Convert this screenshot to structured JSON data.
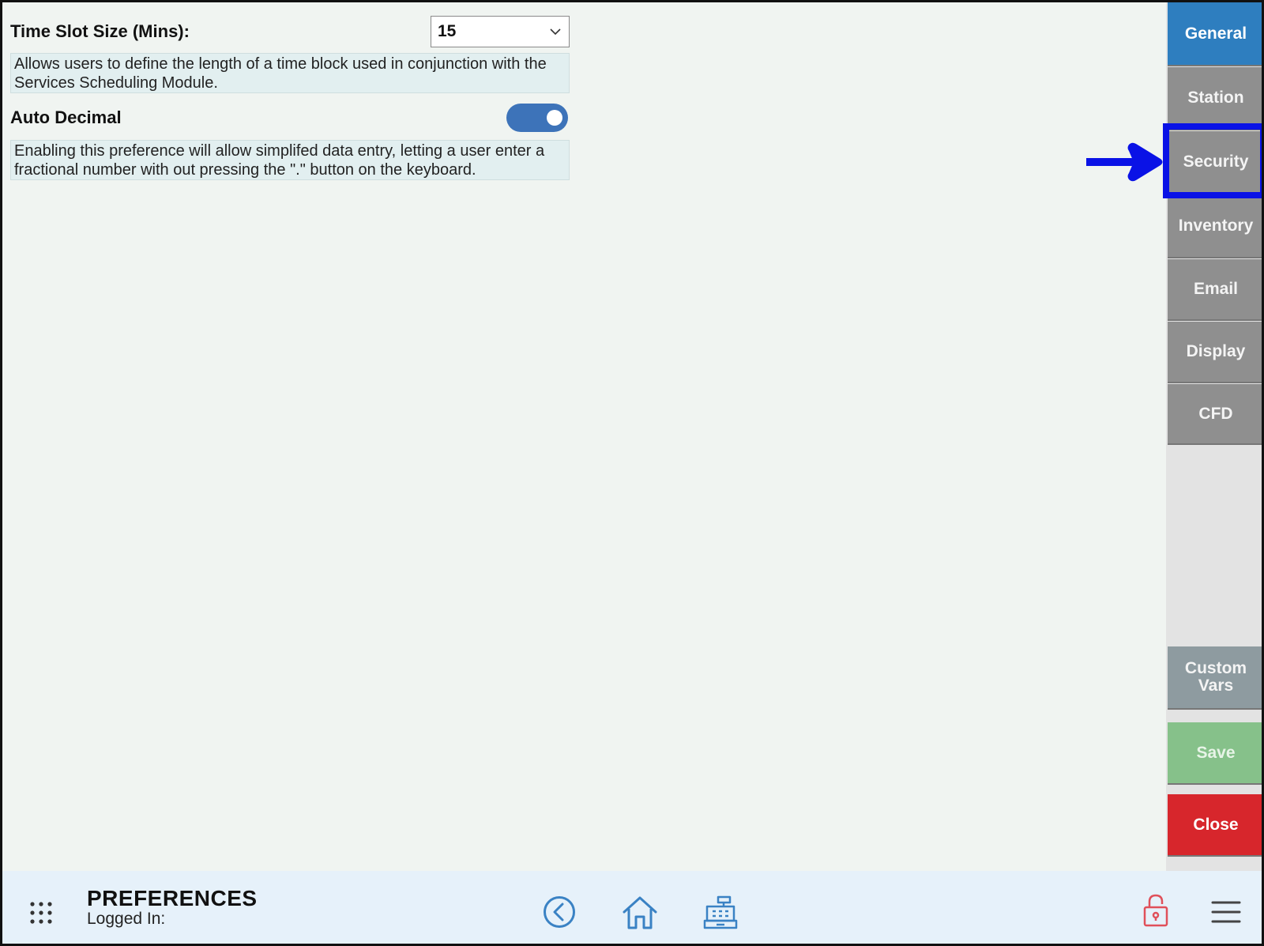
{
  "preferences": {
    "time_slot": {
      "label": "Time Slot Size (Mins):",
      "value": "15",
      "description": "Allows users to define the length of a time block used in conjunction with the Services Scheduling Module."
    },
    "auto_decimal": {
      "label": "Auto Decimal",
      "enabled": true,
      "description": "Enabling this preference will allow simplifed data entry, letting a user enter a fractional number with out pressing the \".\" button on the keyboard."
    }
  },
  "sidebar": {
    "tabs": [
      {
        "label": "General",
        "active": true
      },
      {
        "label": "Station"
      },
      {
        "label": "Security",
        "highlighted": true
      },
      {
        "label": "Inventory"
      },
      {
        "label": "Email"
      },
      {
        "label": "Display"
      },
      {
        "label": "CFD"
      }
    ],
    "custom_vars": "Custom Vars",
    "save": "Save",
    "close": "Close"
  },
  "bottombar": {
    "title": "PREFERENCES",
    "subtitle": "Logged In:",
    "icons": [
      "grid-icon",
      "back-icon",
      "home-icon",
      "register-icon",
      "lock-icon",
      "menu-icon"
    ]
  },
  "colors": {
    "accent": "#2e7ebf",
    "toggle": "#3d73b9",
    "highlight": "#0a12e6",
    "save": "#86c18a",
    "close": "#d7262c",
    "icon": "#3a82c4"
  }
}
